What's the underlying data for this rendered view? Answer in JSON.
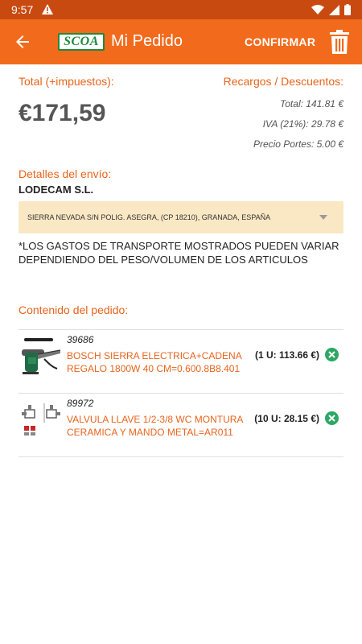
{
  "status_bar": {
    "time": "9:57"
  },
  "app_bar": {
    "logo_text": "SCOA",
    "title": "Mi Pedido",
    "confirm_label": "CONFIRMAR"
  },
  "summary": {
    "total_label": "Total (+impuestos):",
    "surcharges_label": "Recargos / Descuentos:",
    "total_amount": "€171,59",
    "breakdown": [
      "Total: 141.81 €",
      "IVA (21%): 29.78 €",
      "Precio Portes: 5.00 €"
    ]
  },
  "shipping": {
    "label": "Detalles del envío:",
    "company": "LODECAM S.L.",
    "address": "SIERRA NEVADA S/N POLIG. ASEGRA, (CP 18210), GRANADA, ESPAÑA",
    "note": "*LOS GASTOS DE TRANSPORTE MOSTRADOS PUEDEN VARIAR DEPENDIENDO DEL PESO/VOLUMEN DE LOS ARTICULOS"
  },
  "order": {
    "label": "Contenido del pedido:",
    "items": [
      {
        "code": "39686",
        "name": "BOSCH SIERRA ELECTRICA+CADENA REGALO 1800W 40 CM=0.600.8B8.401",
        "qty_price": "(1 U: 113.66 €)",
        "thumb_icon": "chainsaw-icon"
      },
      {
        "code": "89972",
        "name": "VALVULA LLAVE  1/2-3/8 WC MONTURA CERAMICA Y MANDO METAL=AR011",
        "qty_price": "(10 U: 28.15 €)",
        "thumb_icon": "valve-icon"
      }
    ]
  },
  "colors": {
    "status_bar": "#c84a10",
    "app_bar": "#f26b1d",
    "accent_text": "#e8641c",
    "address_bg": "#fae8c4",
    "remove_button": "#2ba862",
    "logo_green": "#1e8a3c"
  }
}
